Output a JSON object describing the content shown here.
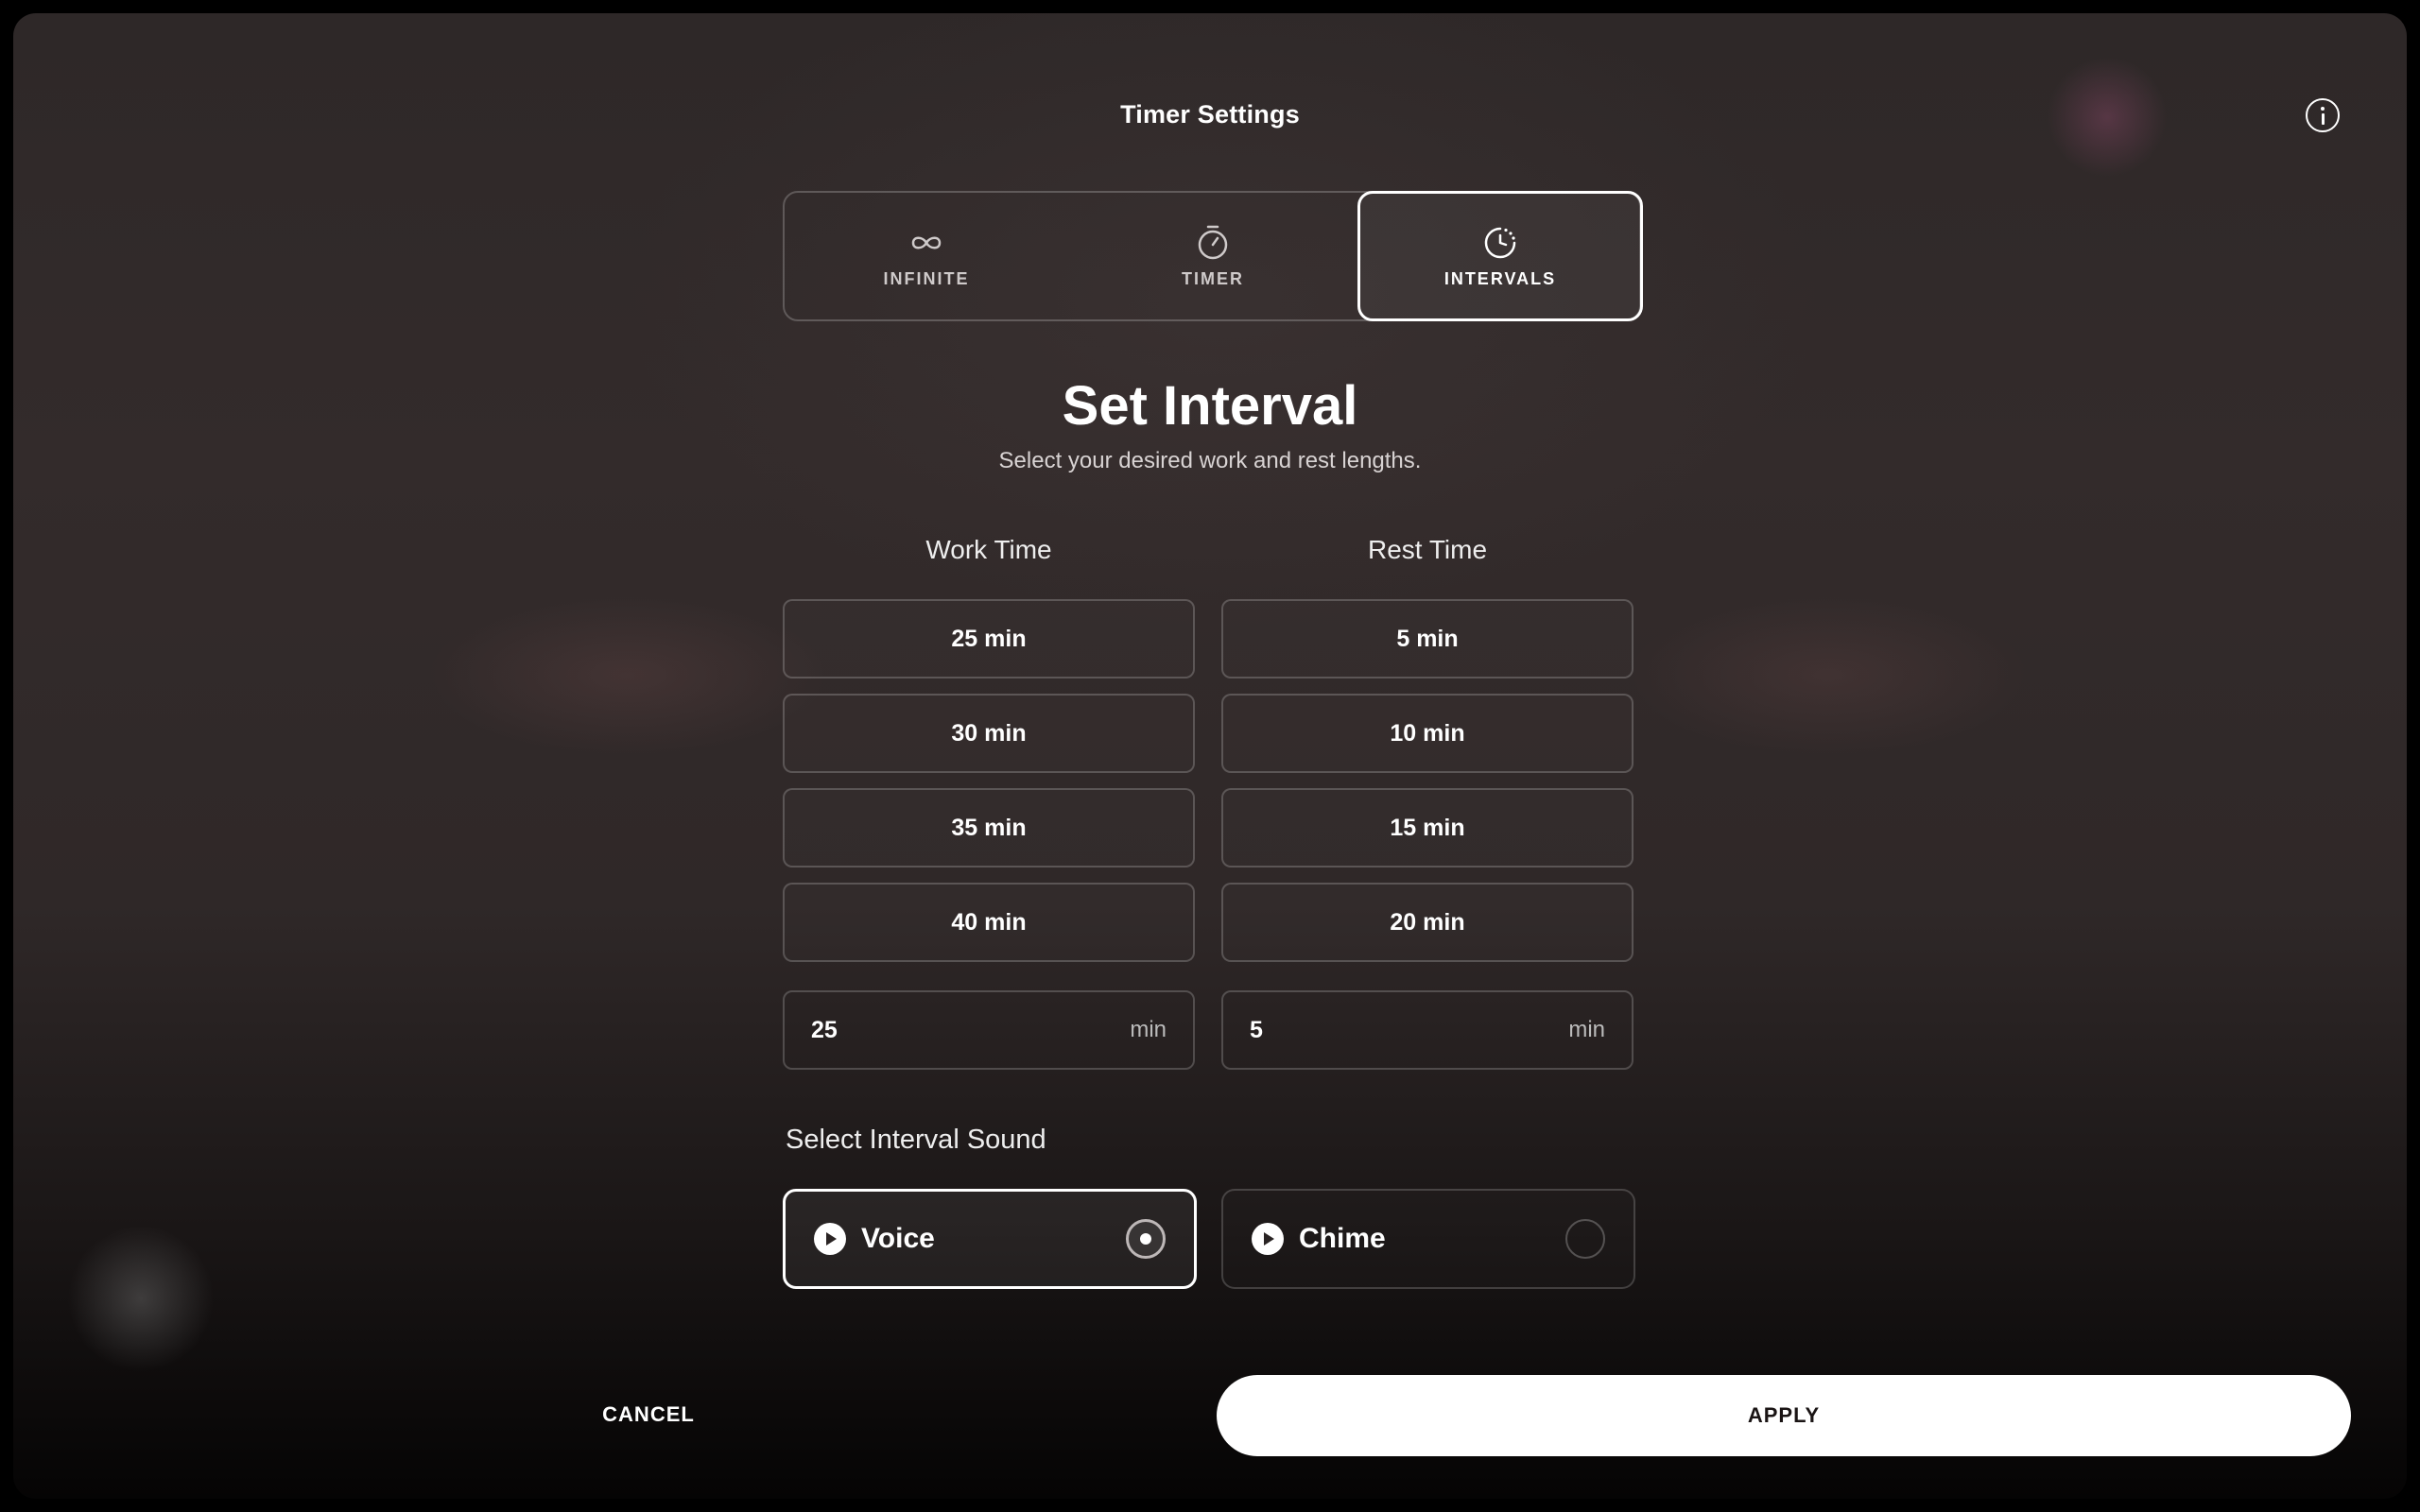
{
  "window": {
    "title": "Timer Settings"
  },
  "icons": {
    "info": "info-icon",
    "infinite": "infinity-icon",
    "timer": "stopwatch-icon",
    "intervals": "interval-clock-icon",
    "play": "play-icon"
  },
  "mode_tabs": {
    "selected": "INTERVALS",
    "items": [
      {
        "label": "INFINITE"
      },
      {
        "label": "TIMER"
      },
      {
        "label": "INTERVALS"
      }
    ]
  },
  "main": {
    "heading": "Set Interval",
    "subheading": "Select your desired work and rest lengths."
  },
  "work": {
    "label": "Work Time",
    "options": [
      "25 min",
      "30 min",
      "35 min",
      "40 min"
    ],
    "custom_value": "25",
    "unit": "min"
  },
  "rest": {
    "label": "Rest Time",
    "options": [
      "5 min",
      "10 min",
      "15 min",
      "20 min"
    ],
    "custom_value": "5",
    "unit": "min"
  },
  "sound": {
    "label": "Select Interval Sound",
    "selected": "Voice",
    "options": [
      {
        "name": "Voice"
      },
      {
        "name": "Chime"
      }
    ]
  },
  "footer": {
    "cancel_label": "CANCEL",
    "apply_label": "APPLY"
  },
  "colors": {
    "background": "#2f2828",
    "accent": "#ffffff",
    "apply_text": "#1a1414"
  }
}
